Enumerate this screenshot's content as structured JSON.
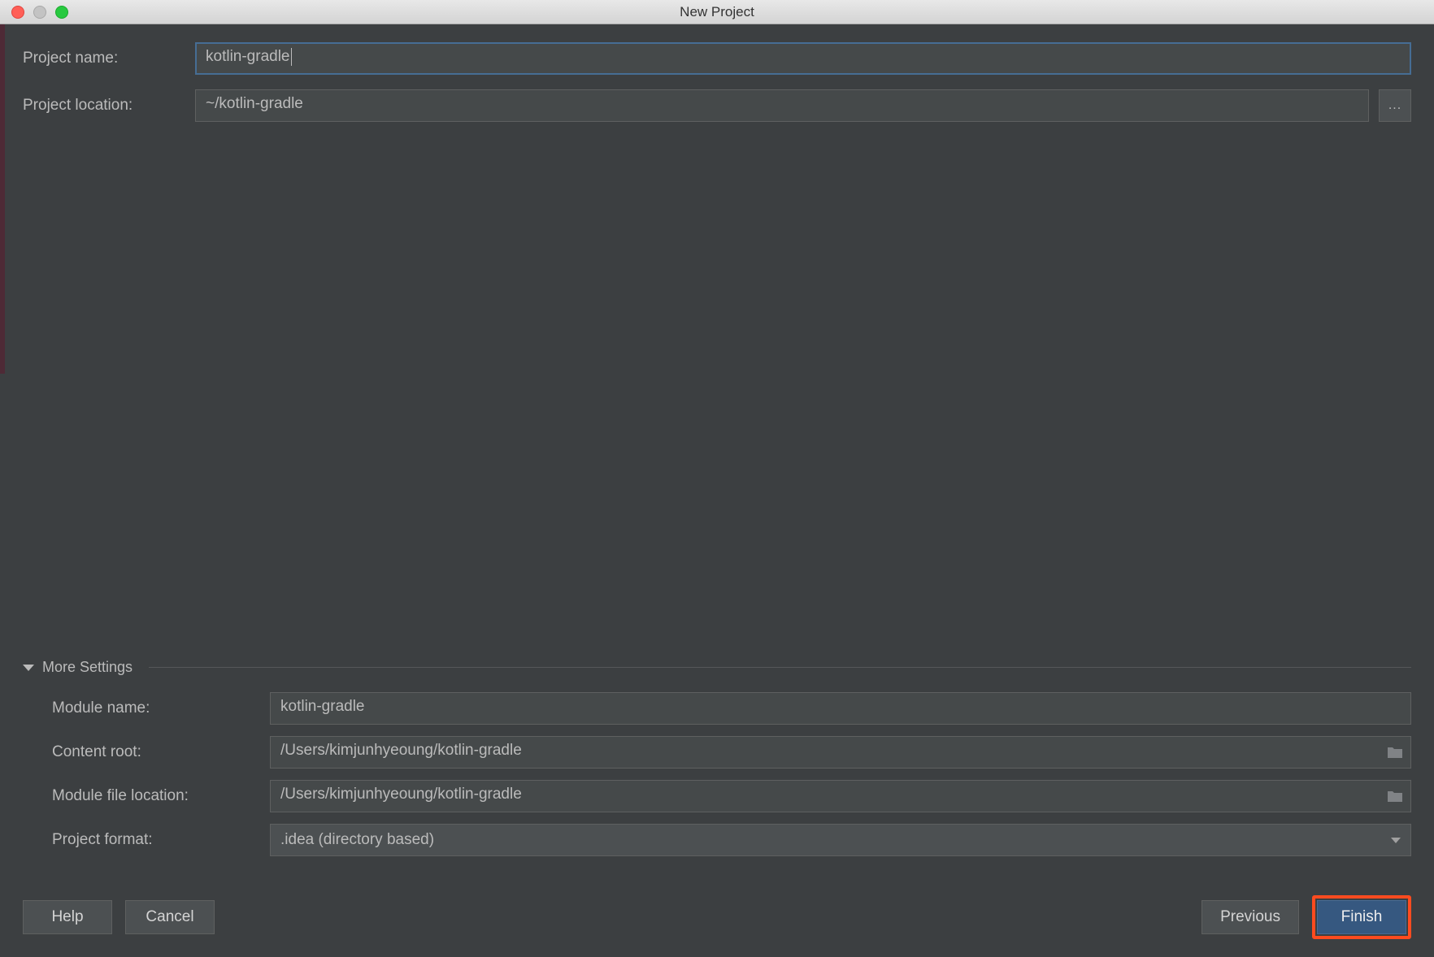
{
  "window": {
    "title": "New Project"
  },
  "top_form": {
    "project_name_label": "Project name:",
    "project_name_value": "kotlin-gradle",
    "project_location_label": "Project location:",
    "project_location_value": "~/kotlin-gradle",
    "browse_glyph": "..."
  },
  "more_settings": {
    "section_label": "More Settings",
    "module_name_label": "Module name:",
    "module_name_value": "kotlin-gradle",
    "content_root_label": "Content root:",
    "content_root_value": "/Users/kimjunhyeoung/kotlin-gradle",
    "module_file_location_label": "Module file location:",
    "module_file_location_value": "/Users/kimjunhyeoung/kotlin-gradle",
    "project_format_label": "Project format:",
    "project_format_value": ".idea (directory based)"
  },
  "buttons": {
    "help": "Help",
    "cancel": "Cancel",
    "previous": "Previous",
    "finish": "Finish"
  }
}
